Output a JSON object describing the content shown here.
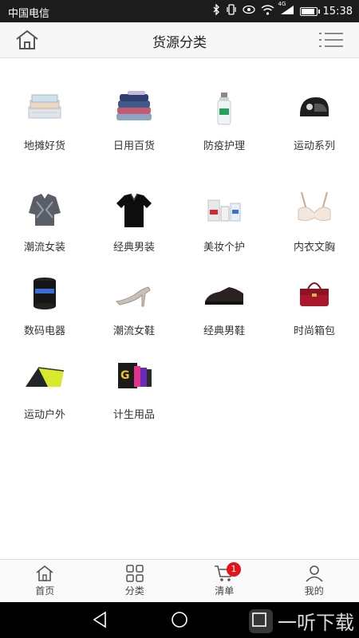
{
  "status_bar": {
    "carrier": "中国电信",
    "signal_badge": "4G",
    "time": "15:38"
  },
  "header": {
    "title": "货源分类"
  },
  "categories": [
    {
      "label": "地摊好货"
    },
    {
      "label": "日用百货"
    },
    {
      "label": "防疫护理"
    },
    {
      "label": "运动系列"
    },
    {
      "label": "潮流女装"
    },
    {
      "label": "经典男装"
    },
    {
      "label": "美妆个护"
    },
    {
      "label": "内衣文胸"
    },
    {
      "label": "数码电器"
    },
    {
      "label": "潮流女鞋"
    },
    {
      "label": "经典男鞋"
    },
    {
      "label": "时尚箱包"
    },
    {
      "label": "运动户外"
    },
    {
      "label": "计生用品"
    }
  ],
  "tabbar": {
    "items": [
      {
        "label": "首页"
      },
      {
        "label": "分类"
      },
      {
        "label": "清单"
      },
      {
        "label": "我的"
      }
    ],
    "cart_badge": "1"
  },
  "watermark": {
    "text": "一听下载"
  },
  "colors": {
    "accent": "#e3121b",
    "status_bar": "#1c1c1c",
    "header_bg": "#f7f7f7"
  }
}
